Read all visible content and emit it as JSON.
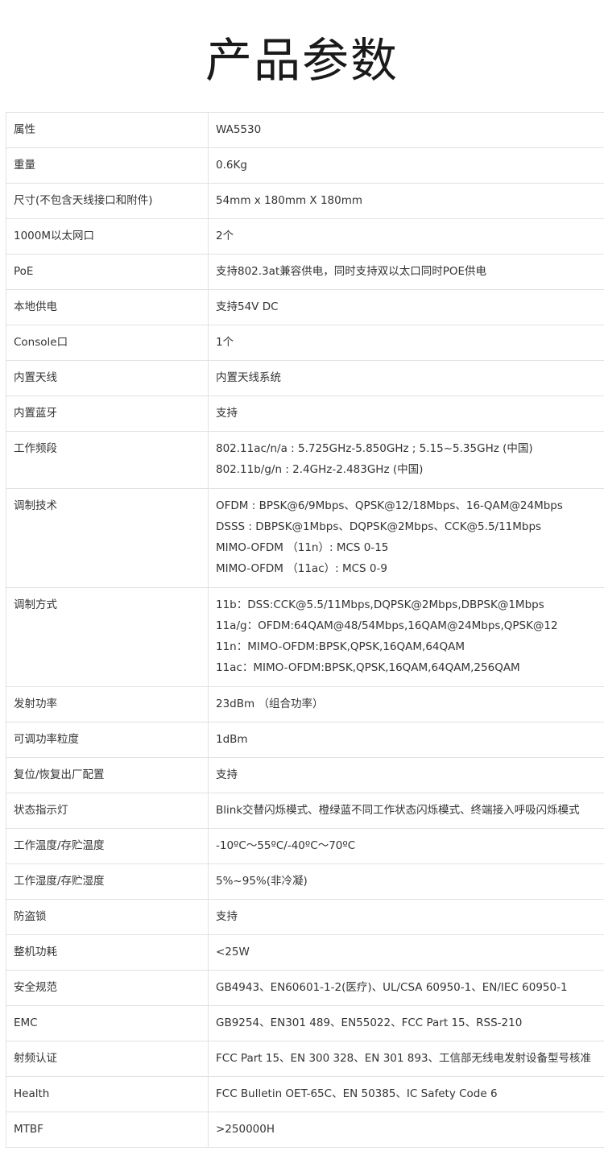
{
  "title": "产品参数",
  "rows": [
    {
      "key": "属性",
      "values": [
        "WA5530"
      ]
    },
    {
      "key": "重量",
      "values": [
        "0.6Kg"
      ]
    },
    {
      "key": "尺寸(不包含天线接口和附件)",
      "values": [
        "54mm x 180mm X 180mm"
      ]
    },
    {
      "key": "1000M以太网口",
      "values": [
        "2个"
      ]
    },
    {
      "key": "PoE",
      "values": [
        "支持802.3at兼容供电，同时支持双以太口同时POE供电"
      ]
    },
    {
      "key": "本地供电",
      "values": [
        "支持54V DC"
      ]
    },
    {
      "key": "Console口",
      "values": [
        "1个"
      ]
    },
    {
      "key": "内置天线",
      "values": [
        "内置天线系统"
      ]
    },
    {
      "key": "内置蓝牙",
      "values": [
        "支持"
      ]
    },
    {
      "key": "工作频段",
      "values": [
        "802.11ac/n/a : 5.725GHz-5.850GHz ; 5.15~5.35GHz (中国)",
        "802.11b/g/n : 2.4GHz-2.483GHz (中国)"
      ]
    },
    {
      "key": "调制技术",
      "values": [
        "OFDM : BPSK@6/9Mbps、QPSK@12/18Mbps、16-QAM@24Mbps",
        "DSSS : DBPSK@1Mbps、DQPSK@2Mbps、CCK@5.5/11Mbps",
        "MIMO-OFDM （11n）: MCS 0-15",
        "MIMO-OFDM （11ac）: MCS 0-9"
      ]
    },
    {
      "key": "调制方式",
      "values": [
        "11b：DSS:CCK@5.5/11Mbps,DQPSK@2Mbps,DBPSK@1Mbps",
        "11a/g：OFDM:64QAM@48/54Mbps,16QAM@24Mbps,QPSK@12",
        "11n：MIMO-OFDM:BPSK,QPSK,16QAM,64QAM",
        "11ac：MIMO-OFDM:BPSK,QPSK,16QAM,64QAM,256QAM"
      ]
    },
    {
      "key": "发射功率",
      "values": [
        "23dBm （组合功率）"
      ]
    },
    {
      "key": "可调功率粒度",
      "values": [
        "1dBm"
      ]
    },
    {
      "key": "复位/恢复出厂配置",
      "values": [
        "支持"
      ]
    },
    {
      "key": "状态指示灯",
      "values": [
        "Blink交替闪烁模式、橙绿蓝不同工作状态闪烁模式、终端接入呼吸闪烁模式"
      ]
    },
    {
      "key": "工作温度/存贮温度",
      "values": [
        "-10ºC～55ºC/-40ºC～70ºC"
      ]
    },
    {
      "key": "工作湿度/存贮湿度",
      "values": [
        "5%~95%(非冷凝)"
      ]
    },
    {
      "key": "防盗锁",
      "values": [
        "支持"
      ]
    },
    {
      "key": "整机功耗",
      "values": [
        "<25W"
      ]
    },
    {
      "key": "安全规范",
      "values": [
        "GB4943、EN60601-1-2(医疗)、UL/CSA 60950-1、EN/IEC 60950-1"
      ]
    },
    {
      "key": "EMC",
      "values": [
        "GB9254、EN301 489、EN55022、FCC Part 15、RSS-210"
      ]
    },
    {
      "key": "射频认证",
      "values": [
        "FCC Part 15、EN 300 328、EN 301 893、工信部无线电发射设备型号核准"
      ]
    },
    {
      "key": "Health",
      "values": [
        "FCC Bulletin OET-65C、EN 50385、IC Safety Code 6"
      ]
    },
    {
      "key": "MTBF",
      "values": [
        ">250000H"
      ]
    }
  ]
}
